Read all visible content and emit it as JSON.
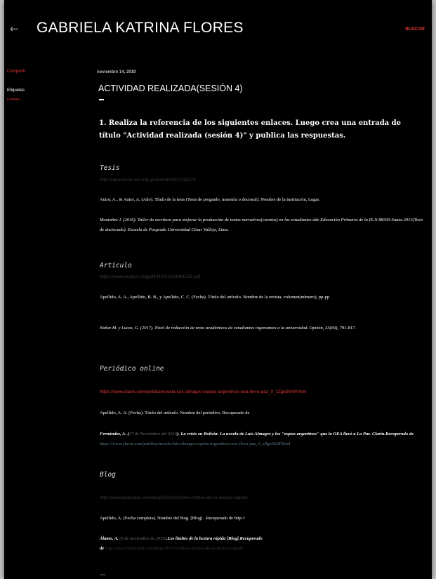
{
  "header": {
    "back_icon": "arrow-left-icon",
    "title": "GABRIELA KATRINA FLORES",
    "search_label": "BUSCAR"
  },
  "sidebar": {
    "share_label": "Compartir",
    "labels_title": "Etiquetas",
    "label_item": "KATRINA"
  },
  "post": {
    "date": "noviembre 14, 2019",
    "title": "ACTIVIDAD REALIZADA(SESIÓN 4)",
    "question": "1. Realiza la referencia de los siguientes enlaces. Luego crea una entrada de título \"Actividad realizada (sesión 4)\" y publica las respuestas.",
    "sections": {
      "tesis": {
        "heading": "Tesis",
        "link": "http://repositorio.ucv.edu.pe/handle/UCV/19174",
        "format": "Autor, A., & Autor, A. (Año). Título de la tesis (Tesis de pregrado, maestría o doctoral). Nombre de la institución, Lugar.",
        "reference": "Montañez J. (2016). Taller de escritura para mejorar la producción de textos narrativos(cuentos) en los estudiantes dde Educación Primaria de la IE.N 88330-Santa-2015(Tesis de doctorado).  Escuela de Posgrado Universidad César Vallejo, Lima."
      },
      "articulo": {
        "heading": "Artículo",
        "link": "https://www.redalyc.org/pdf/310/31054991028.pdf",
        "format": "Apellido, A. A., Apellido, B. B., y Apellido, C. C. (Fecha). Título del artículo. Nombre de la revista, volumen(número), pp-pp.",
        "reference": "Nañez M. y Lucas, G. (2017). Nivel de redacción de texto académicos de estudiantes ingresantes a la universidad. Opción, 33(84), 791-817."
      },
      "periodico": {
        "heading": "Periódico online",
        "link": "https://www.clarin.com/politica/novela-luis-almagro-espias-argentinos-oea-llevo-paz_0_zZge3hAP.html",
        "format": "Apellido, A. A. (Fecha). Título del artículo. Nombre del periódico. Recuperado de",
        "ref_author": "Fernández, A. (",
        "ref_date": "17 de Noviembre del 2019",
        "ref_title": ").  La crisis en Bolivia: La novela de Luis Almagro y los \"espías argentinos\" que la OEA llevó a La Paz. Clarin.Recuperado de ",
        "ref_link": "https://www.clarin.com/politica/novela-luis-almagro-espias-argentinos-oea-llevo-paz_0_zZge3hAP.html"
      },
      "blog": {
        "heading": "Blog",
        "link": "http://www.lecturalia.com/blog/2019/11/06/los-limites-de-la-lectura-rapida/",
        "format": "Apellido, A. (Fecha completa). Nombre del blog. [Blog] . Recuperado de http://",
        "ref_author": "Álamo, A. ",
        "ref_date": "(6 de noviembre de 2019)",
        "ref_title": ".Los límites de la lectura rápida [Blog].Recuperado",
        "ref_prefix": "de ",
        "ref_link": "http://www.lecturalia.com/blog/2019/11/06/los-limites-de-la-lectura-rapida"
      }
    }
  },
  "colors": {
    "background": "#000000",
    "accent_red": "#e53935",
    "text": "#ffffff",
    "muted_link": "#3a3a3a"
  }
}
